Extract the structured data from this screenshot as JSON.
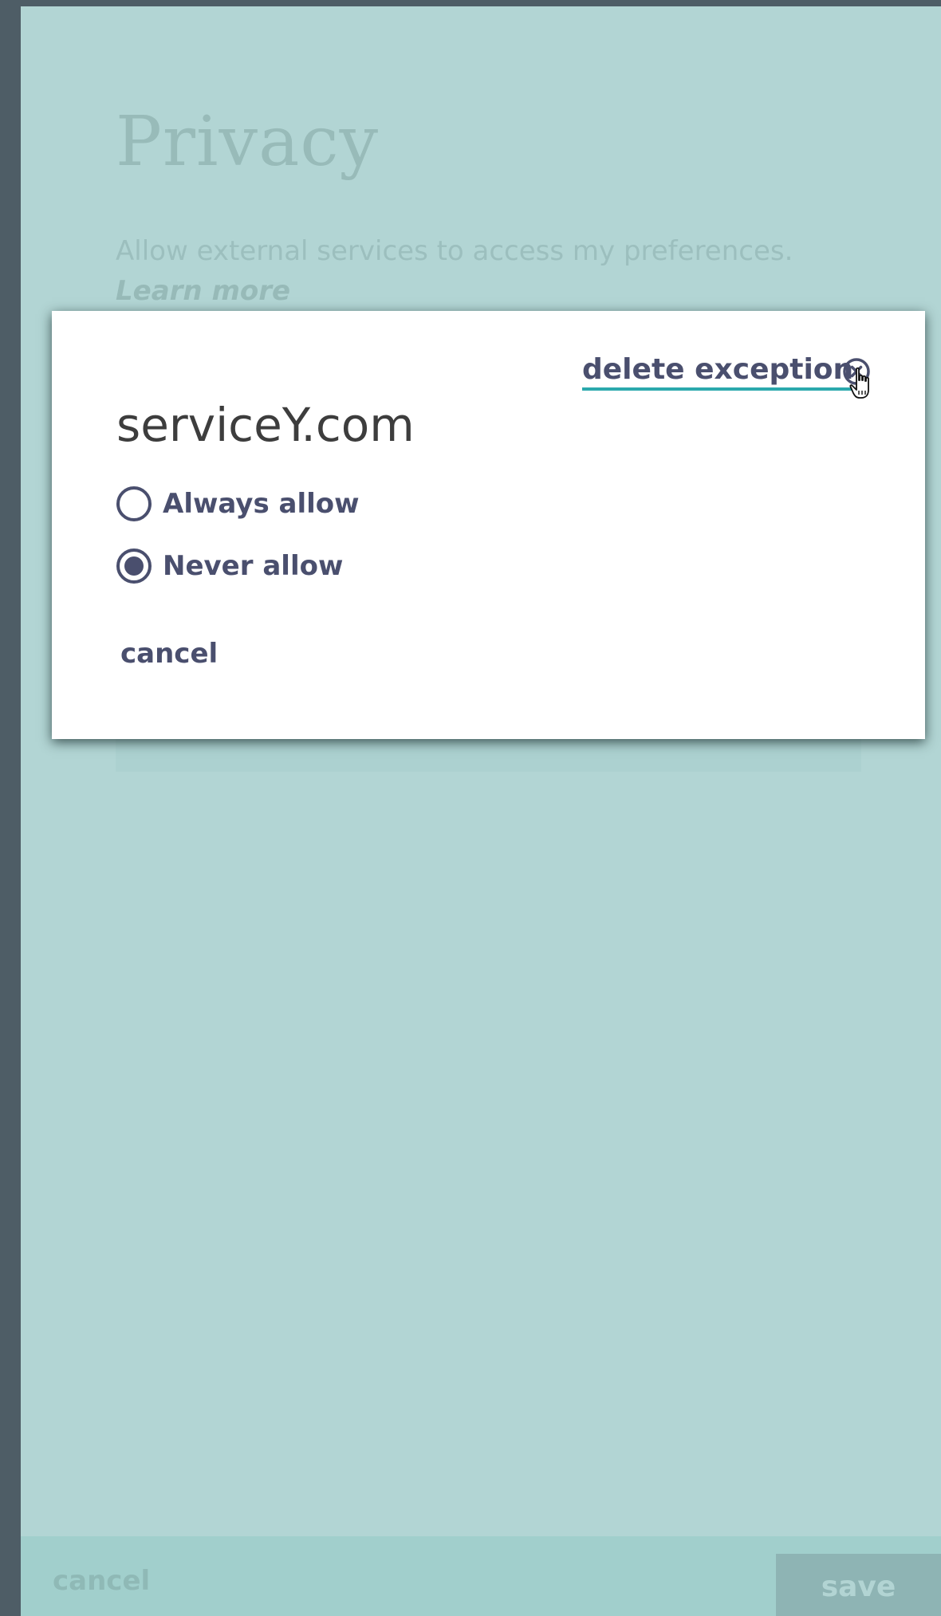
{
  "page": {
    "title": "Privacy",
    "description": "Allow external services to access my preferences.",
    "learn_more": "Learn more"
  },
  "footer": {
    "cancel_label": "cancel",
    "save_label": "save"
  },
  "modal": {
    "service_name": "serviceY.com",
    "delete_label": "delete exception",
    "delete_icon": "close-circle-icon",
    "options": [
      {
        "label": "Always allow",
        "selected": false
      },
      {
        "label": "Never allow",
        "selected": true
      }
    ],
    "cancel_label": "cancel"
  },
  "colors": {
    "accent": "#2ba9ad",
    "text_primary": "#4a4f6e",
    "backdrop": "#b2d5d4",
    "chrome": "#4e5d66"
  }
}
